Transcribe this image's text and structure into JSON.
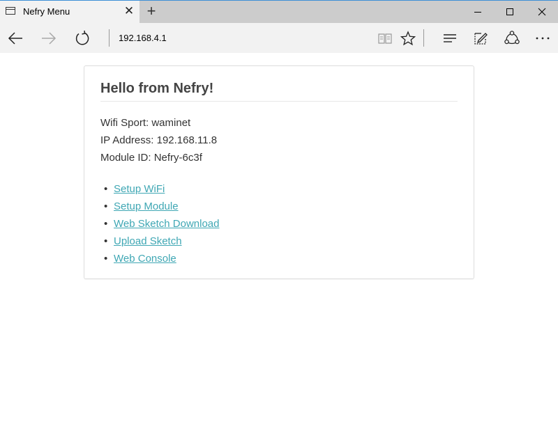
{
  "browser": {
    "tab": {
      "title": "Nefry Menu",
      "close_glyph": "✕",
      "icon": "page-icon"
    },
    "new_tab_glyph": "+",
    "address": "192.168.4.1",
    "window_controls": [
      "minimize-icon",
      "maximize-icon",
      "close-icon"
    ],
    "toolbar_icons": [
      "back-arrow-icon",
      "forward-arrow-icon",
      "refresh-icon",
      "reading-view-icon",
      "favorite-star-icon",
      "hub-icon",
      "web-note-icon",
      "share-icon",
      "more-icon"
    ],
    "accent_color": "#3c8fd6"
  },
  "page": {
    "title": "Hello from Nefry!",
    "info": {
      "wifi": "Wifi Sport: waminet",
      "ip": "IP Address: 192.168.11.8",
      "module": "Module ID: Nefry-6c3f"
    },
    "bullet": "•",
    "links": [
      "Setup WiFi",
      "Setup Module",
      "Web Sketch Download",
      "Upload Sketch",
      "Web Console"
    ],
    "link_color": "#3fa7b4"
  }
}
